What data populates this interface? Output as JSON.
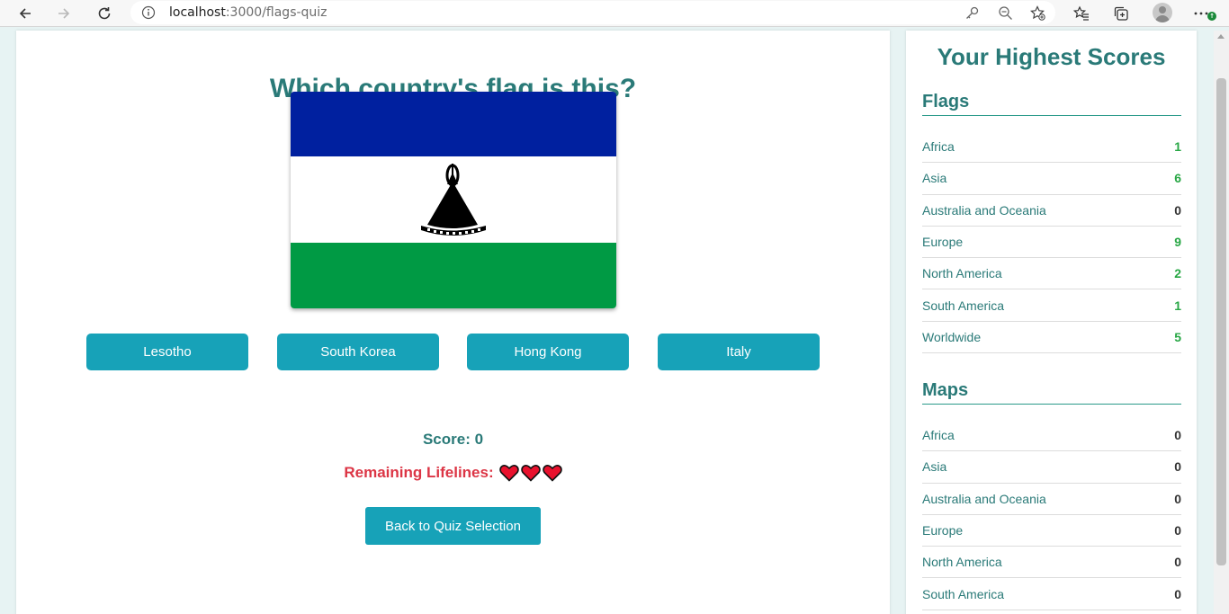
{
  "browser": {
    "url_host": "localhost",
    "url_path": ":3000/flags-quiz"
  },
  "quiz": {
    "question": "Which country's flag is this?",
    "options": [
      "Lesotho",
      "South Korea",
      "Hong Kong",
      "Italy"
    ],
    "score_text": "Score: 0",
    "lifelines_label": "Remaining Lifelines:",
    "lifelines_count": 3,
    "back_label": "Back to Quiz Selection"
  },
  "sidebar": {
    "title": "Your Highest Scores",
    "flags": {
      "title": "Flags",
      "rows": [
        {
          "label": "Africa",
          "value": "1"
        },
        {
          "label": "Asia",
          "value": "6"
        },
        {
          "label": "Australia and Oceania",
          "value": "0"
        },
        {
          "label": "Europe",
          "value": "9"
        },
        {
          "label": "North America",
          "value": "2"
        },
        {
          "label": "South America",
          "value": "1"
        },
        {
          "label": "Worldwide",
          "value": "5"
        }
      ]
    },
    "maps": {
      "title": "Maps",
      "rows": [
        {
          "label": "Africa",
          "value": "0"
        },
        {
          "label": "Asia",
          "value": "0"
        },
        {
          "label": "Australia and Oceania",
          "value": "0"
        },
        {
          "label": "Europe",
          "value": "0"
        },
        {
          "label": "North America",
          "value": "0"
        },
        {
          "label": "South America",
          "value": "0"
        }
      ]
    }
  },
  "colors": {
    "accent": "#2a7a78",
    "button": "#17a2b8",
    "score_positive": "#28a745",
    "score_zero": "#333333",
    "lifeline": "#dc3545"
  },
  "icons": {
    "back": "back-arrow-icon",
    "forward": "forward-arrow-icon",
    "reload": "reload-icon",
    "info": "info-icon",
    "key": "key-icon",
    "zoom": "zoom-out-icon",
    "favorite_add": "star-add-icon",
    "favorites": "favorites-icon",
    "collections": "collections-icon",
    "profile": "profile-avatar",
    "menu": "more-menu-icon",
    "heart": "heart-icon"
  }
}
